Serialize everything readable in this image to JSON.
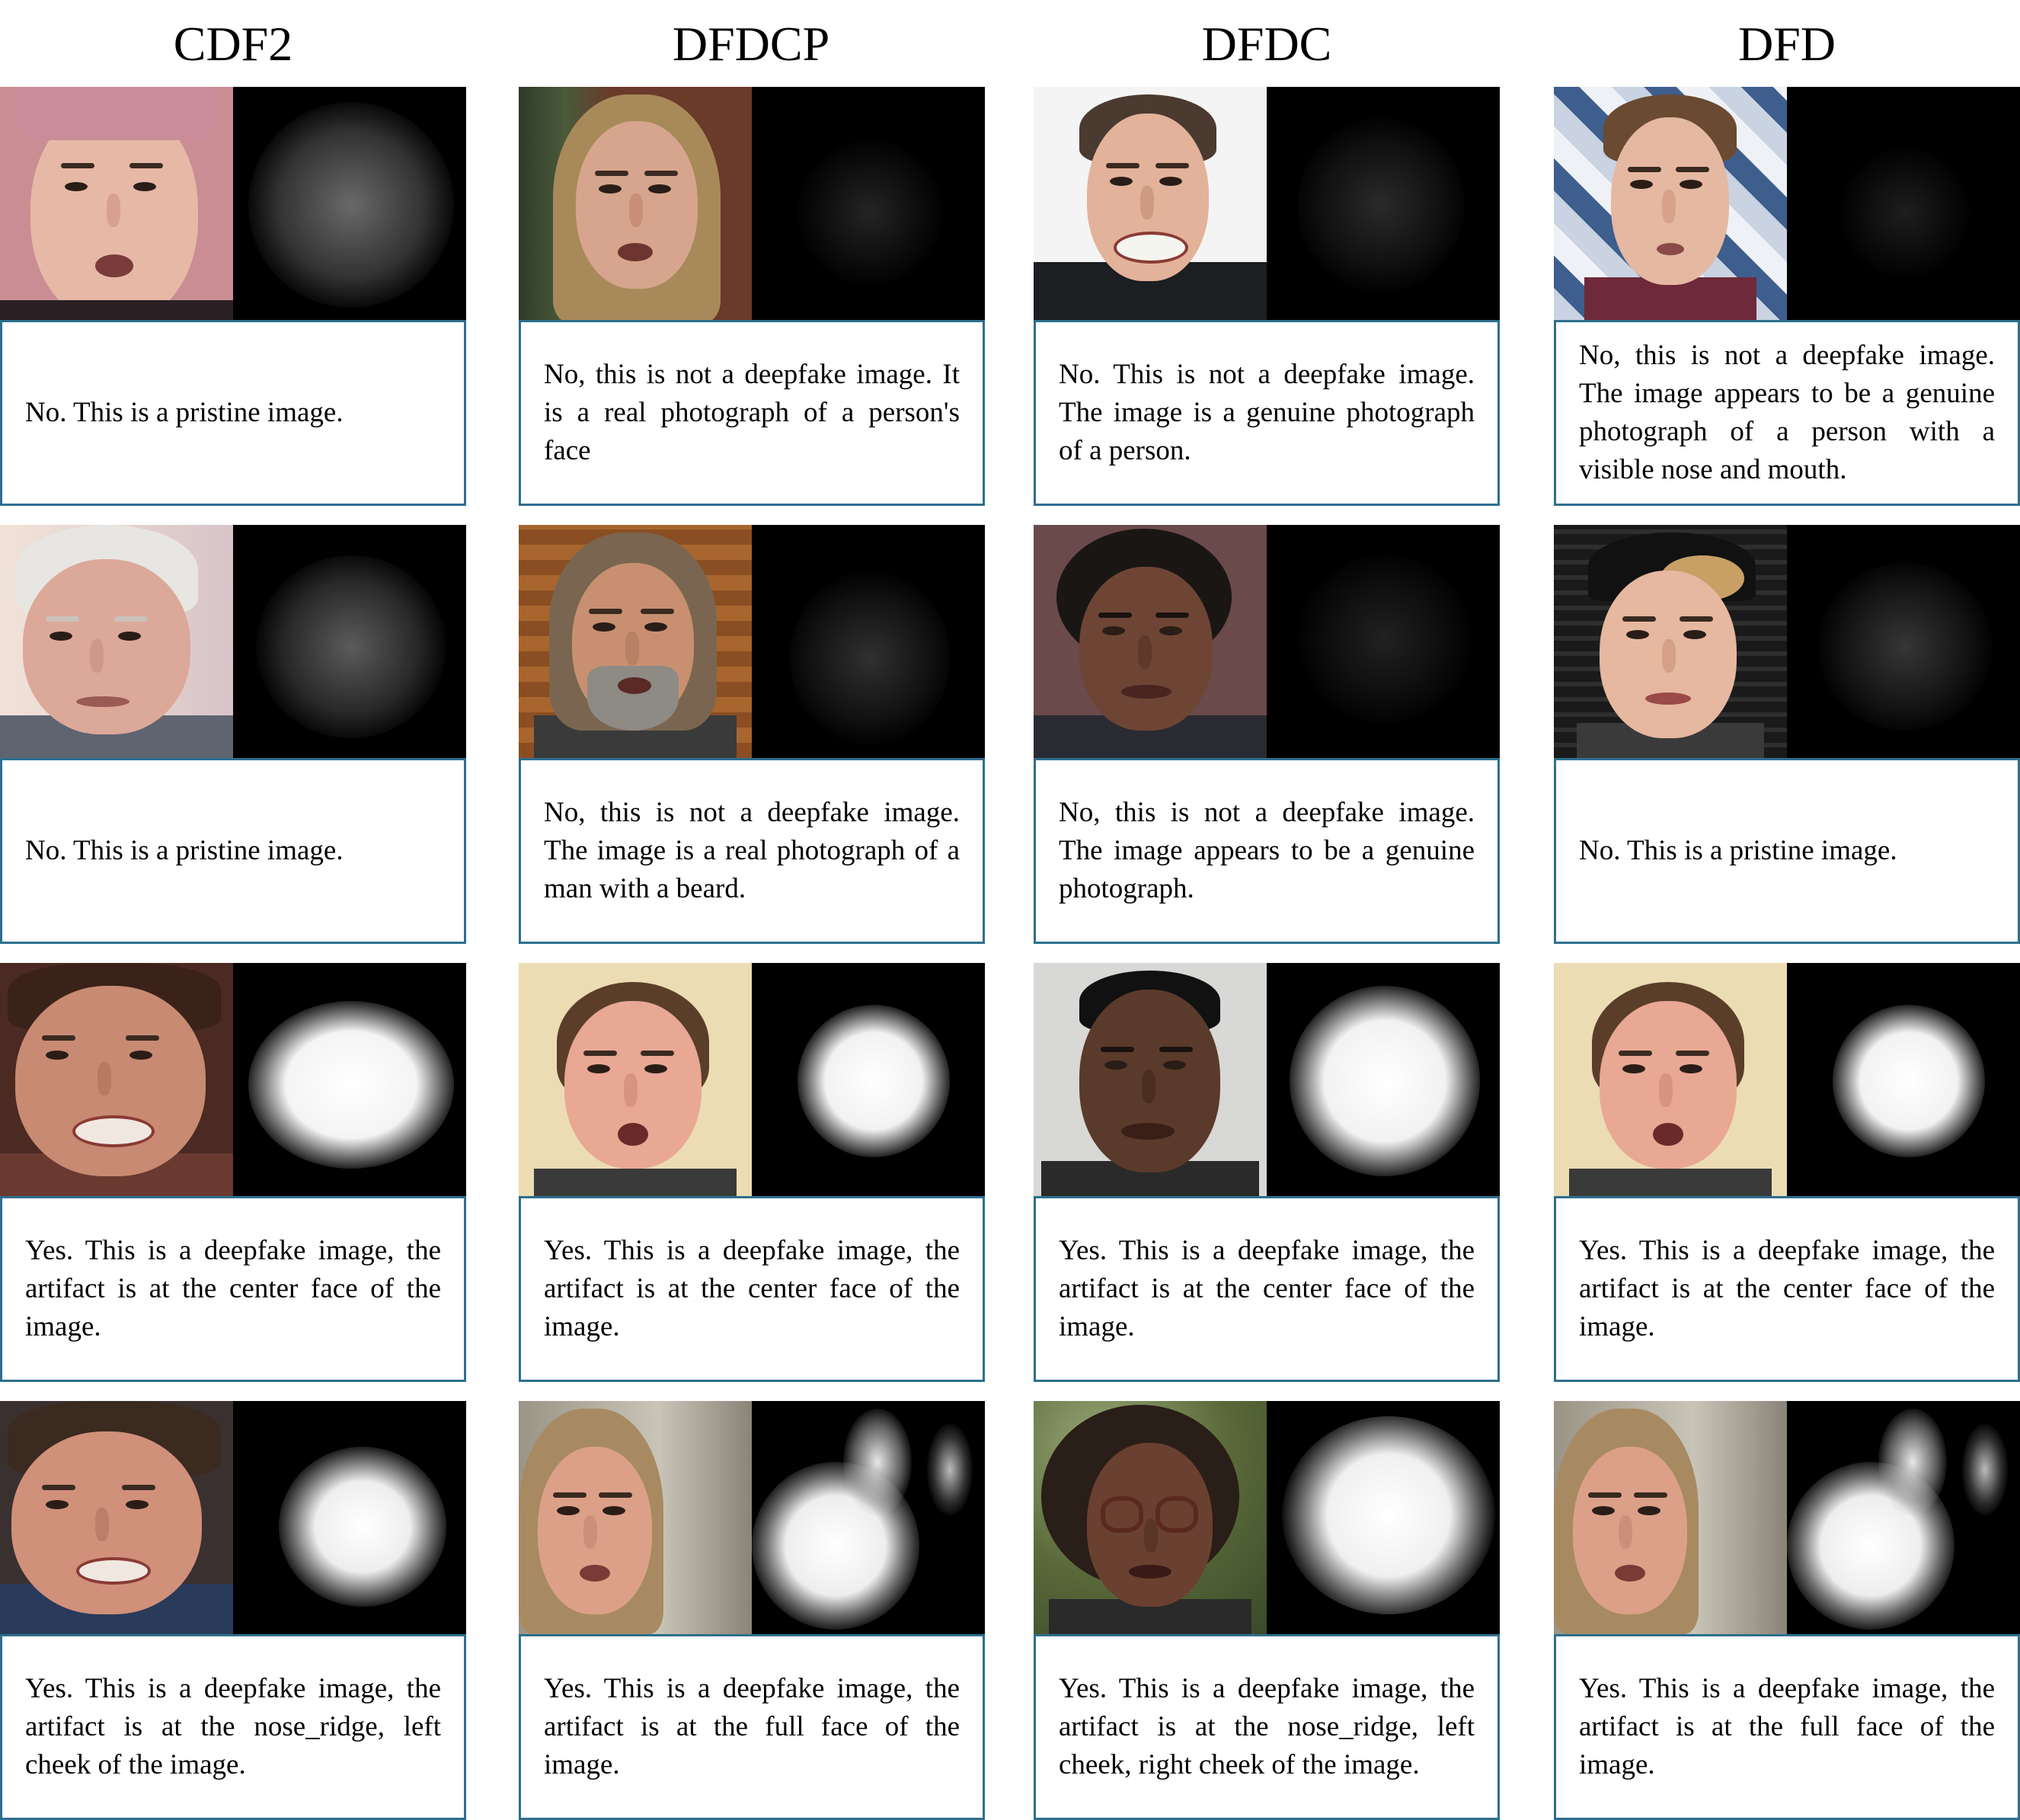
{
  "columns": [
    {
      "title": "CDF2"
    },
    {
      "title": "DFDCP"
    },
    {
      "title": "DFDC"
    },
    {
      "title": "DFD"
    }
  ],
  "rows": [
    {
      "cells": [
        {
          "caption": "No. This is a pristine image."
        },
        {
          "caption": "No, this is not a deepfake image. It is a real photograph of a person's face"
        },
        {
          "caption": "No. This is not a deepfake image. The image is a genuine photograph of a person."
        },
        {
          "caption": "No, this is not a deepfake image. The image appears to be a genuine photograph of a person with a visible nose and mouth."
        }
      ]
    },
    {
      "cells": [
        {
          "caption": "No. This is a pristine image."
        },
        {
          "caption": "No, this is not a deepfake image. The image is a real photograph of a man with a beard."
        },
        {
          "caption": "No, this is not a deepfake image. The image appears to be a genuine photograph."
        },
        {
          "caption": "No. This is a pristine image."
        }
      ]
    },
    {
      "cells": [
        {
          "caption": "Yes. This is a deepfake image, the artifact is at the center face of the image."
        },
        {
          "caption": "Yes. This is a deepfake image, the artifact is at the center face of the image."
        },
        {
          "caption": "Yes. This is a deepfake image, the artifact is at the center face of the image."
        },
        {
          "caption": "Yes. This is a deepfake image, the artifact is at the center face of the image."
        }
      ]
    },
    {
      "cells": [
        {
          "caption": "Yes. This is a deepfake image, the artifact is at the nose_ridge, left cheek of the image."
        },
        {
          "caption": "Yes. This is a deepfake image, the artifact is at the full face of the image."
        },
        {
          "caption": "Yes. This is a deepfake image, the artifact is at the nose_ridge, left cheek, right cheek of the image."
        },
        {
          "caption": "Yes. This is a deepfake image, the artifact is at the full face of the image."
        }
      ]
    }
  ]
}
